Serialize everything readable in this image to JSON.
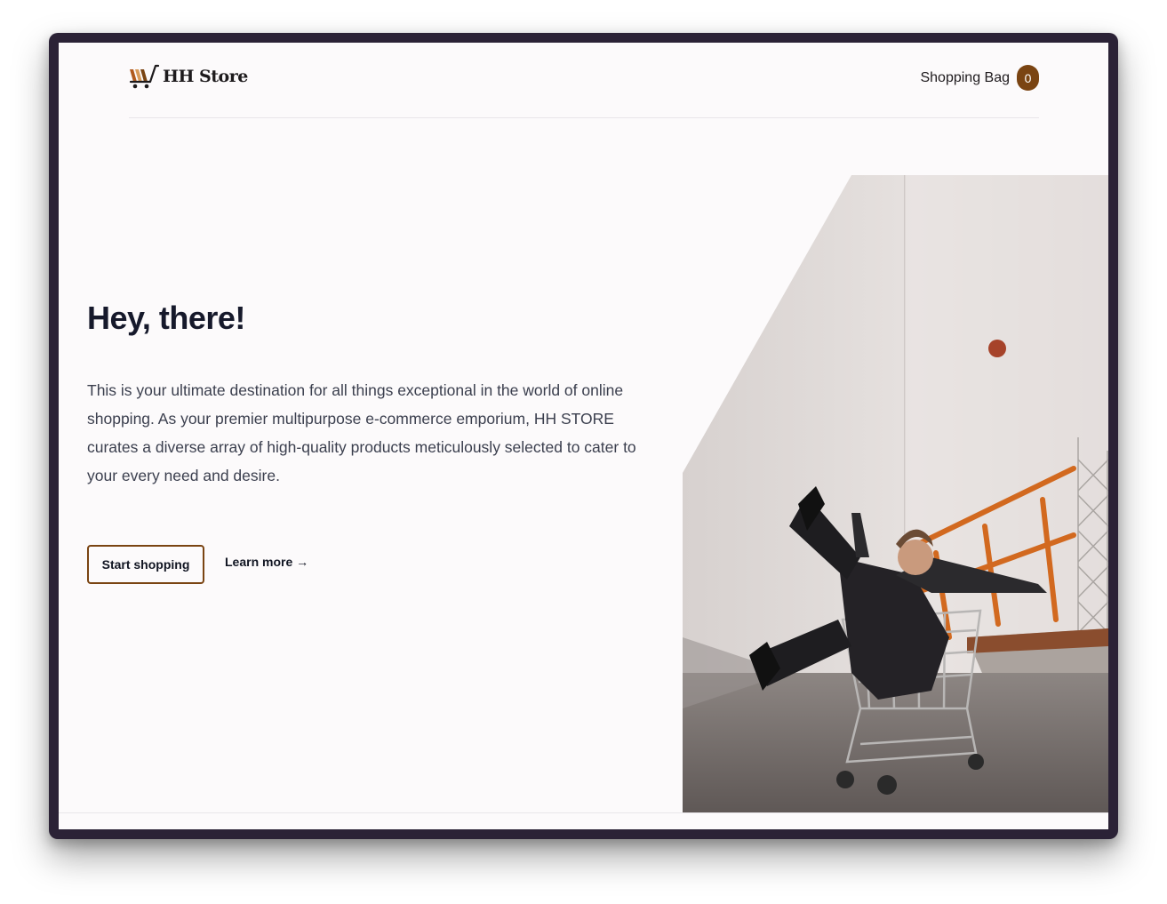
{
  "header": {
    "logo_text": "HH Store",
    "bag_label": "Shopping Bag",
    "bag_count": "0"
  },
  "hero": {
    "title": "Hey, there!",
    "description": "This is your ultimate destination for all things exceptional in the world of online shopping. As your premier multipurpose e-commerce emporium, HH STORE curates a diverse array of high-quality products meticulously selected to cater to your every need and desire.",
    "primary_button": "Start shopping",
    "secondary_link": "Learn more →"
  },
  "icons": {
    "logo": "shopping-cart-logo-icon"
  },
  "colors": {
    "accent": "#7a4412",
    "heading": "#16192b",
    "body_text": "#3b3f4e",
    "page_background": "#fcfafb",
    "frame": "#2b2236"
  }
}
